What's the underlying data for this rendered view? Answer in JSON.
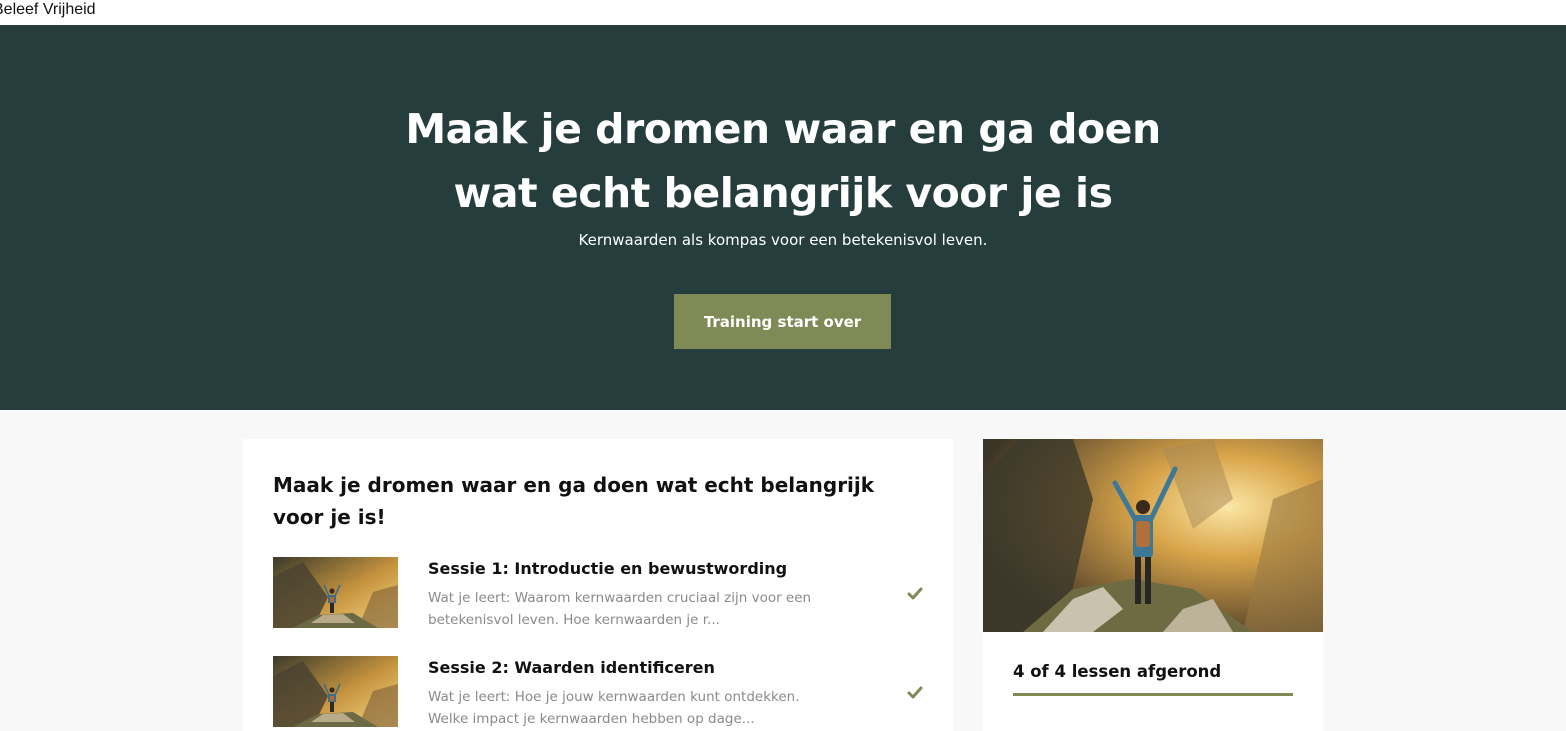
{
  "site": {
    "title": "Beleef Vrijheid"
  },
  "hero": {
    "title_line1": "Maak je dromen waar en ga doen",
    "title_line2": "wat echt belangrijk voor je is",
    "subtitle": "Kernwaarden als kompas voor een betekenisvol leven.",
    "button_label": "Training start over"
  },
  "course": {
    "heading": "Maak je dromen waar en ga doen wat echt belangrijk voor je is!",
    "lessons": [
      {
        "title": "Sessie 1: Introductie en bewustwording",
        "description": "Wat je leert: Waarom kernwaarden cruciaal zijn voor een betekenisvol leven. Hoe kernwaarden je r...",
        "completed": true,
        "status_icon": "check-icon"
      },
      {
        "title": "Sessie 2: Waarden identificeren",
        "description": "Wat je leert: Hoe je jouw kernwaarden kunt ontdekken. Welke impact je kernwaarden hebben op dage...",
        "completed": true,
        "status_icon": "check-icon"
      }
    ]
  },
  "progress": {
    "label": "4 of 4 lessen afgerond",
    "fraction": 1.0
  },
  "colors": {
    "hero_bg": "#263d3e",
    "accent": "#7f8a57",
    "page_bg": "#f8f8f8",
    "muted_text": "#8a8a8a"
  }
}
